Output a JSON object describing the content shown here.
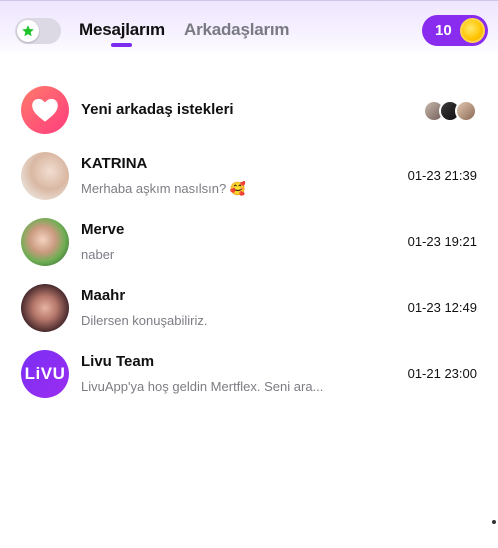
{
  "header": {
    "tabs": [
      {
        "label": "Mesajlarım",
        "active": true
      },
      {
        "label": "Arkadaşlarım",
        "active": false
      }
    ],
    "coins": "10",
    "accent": "#7b2cf0"
  },
  "friend_requests": {
    "label": "Yeni arkadaş istekleri"
  },
  "conversations": [
    {
      "name": "KATRINA",
      "preview": "Merhaba aşkım nasılsın? 🥰",
      "time": "01-23 21:39"
    },
    {
      "name": "Merve",
      "preview": "naber",
      "time": "01-23 19:21"
    },
    {
      "name": "Maahr",
      "preview": "Dilersen konuşabiliriz.",
      "time": "01-23 12:49"
    },
    {
      "name": "Livu Team",
      "preview": "LivuApp'ya hoş geldin Mertflex. Seni ara...",
      "time": "01-21 23:00",
      "avatar_text": "LiVU"
    }
  ]
}
